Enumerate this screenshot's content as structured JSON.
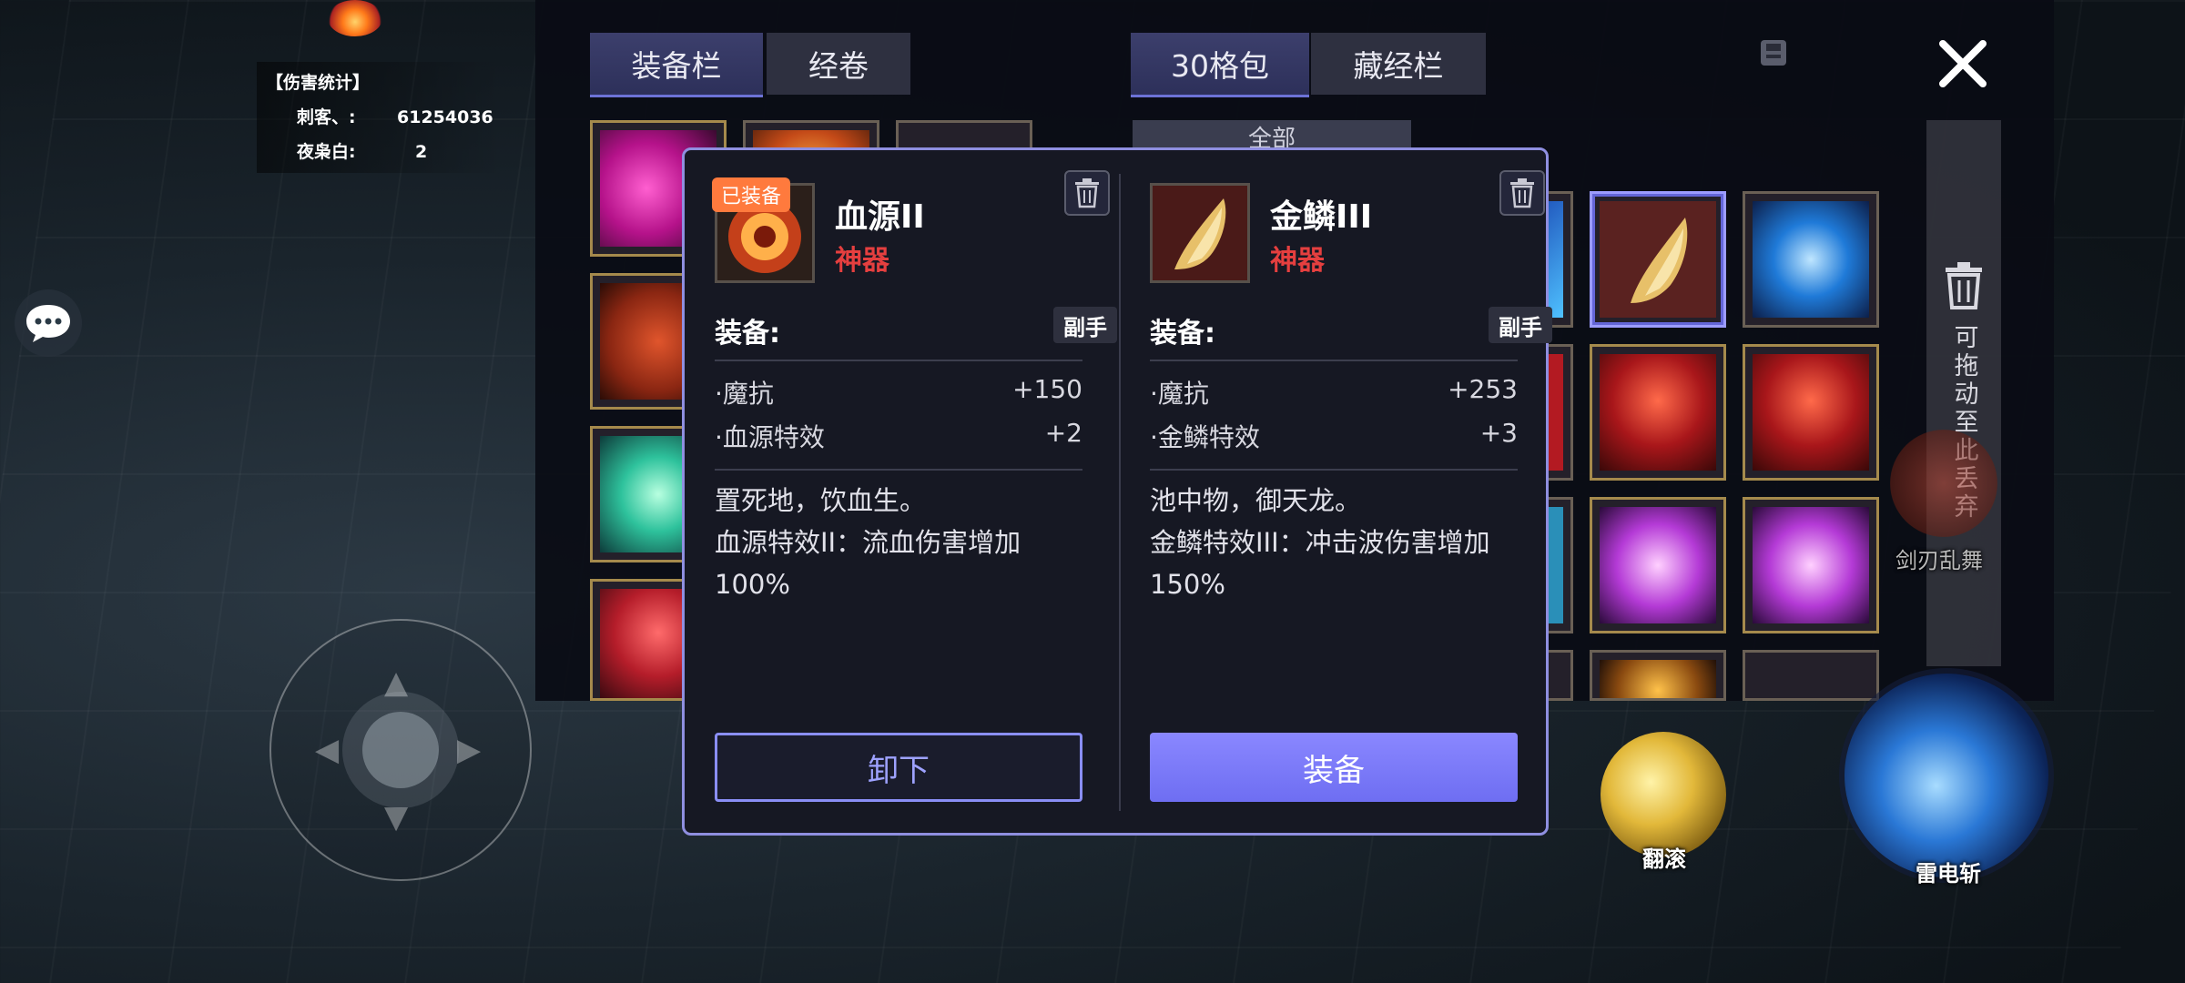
{
  "hud": {
    "damage_title": "【伤害统计】",
    "damage_rows": [
      {
        "name": "刺客、:",
        "value": "61254036"
      },
      {
        "name": "夜枭白:",
        "value": "2"
      }
    ]
  },
  "inventory": {
    "left_tabs": [
      "装备栏",
      "经卷"
    ],
    "right_tabs": [
      "30格包",
      "藏经栏"
    ],
    "filter_value": "全部",
    "drop_zone_text": "可拖动至此丢弃"
  },
  "skills": {
    "roll_label": "翻滚",
    "thunder_label": "雷电斩",
    "sword_label": "剑刃乱舞"
  },
  "dialog": {
    "left": {
      "badge": "已装备",
      "name": "血源II",
      "rarity": "神器",
      "equip_label": "装备:",
      "slot": "副手",
      "stats": [
        {
          "name": "·魔抗",
          "value": "+150"
        },
        {
          "name": "·血源特效",
          "value": "+2"
        }
      ],
      "desc_line1": "置死地，饮血生。",
      "desc_line2": "血源特效II：流血伤害增加100%",
      "action": "卸下"
    },
    "right": {
      "name": "金鳞III",
      "rarity": "神器",
      "equip_label": "装备:",
      "slot": "副手",
      "stats": [
        {
          "name": "·魔抗",
          "value": "+253"
        },
        {
          "name": "·金鳞特效",
          "value": "+3"
        }
      ],
      "desc_line1": "池中物，御天龙。",
      "desc_line2": "金鳞特效III：冲击波伤害增加150%",
      "action": "装备"
    }
  },
  "colors": {
    "accent": "#7c7cf5",
    "rarity_red": "#e53f3f",
    "badge_orange": "#ff7a3d"
  }
}
